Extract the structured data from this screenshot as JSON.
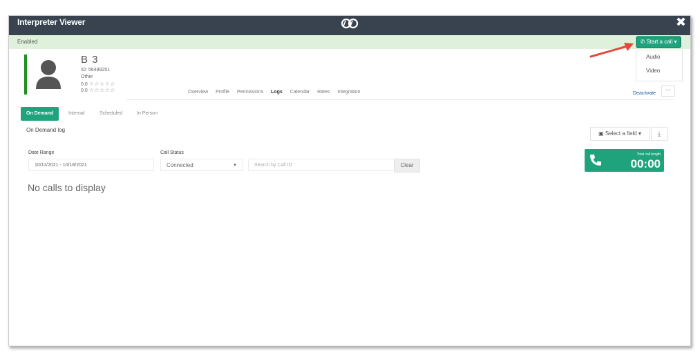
{
  "window": {
    "title": "Interpreter Viewer",
    "close_label": "✖"
  },
  "status": {
    "text": "Enabled",
    "start_call_label": "Start a call",
    "call_options": [
      "Audio",
      "Video"
    ]
  },
  "profile": {
    "name": "B 3",
    "id": "ID: 56489251",
    "type": "Other",
    "rating1": "0.0",
    "rating2": "0.0",
    "stars": "☆☆☆☆☆"
  },
  "tabs": [
    "Overview",
    "Profile",
    "Permissions",
    "Logs",
    "Calendar",
    "Rates",
    "Integration"
  ],
  "active_tab": "Logs",
  "actions": {
    "deactivate": "Deactivate",
    "more": "···"
  },
  "subtabs": [
    "On Demand",
    "Internal",
    "Scheduled",
    "In Person"
  ],
  "log": {
    "title": "On Demand log",
    "select_field": "Select a field",
    "date_range_label": "Date Range",
    "date_range_value": "10/11/2021 - 10/18/2021",
    "call_status_label": "Call Status",
    "call_status_value": "Connected",
    "search_placeholder": "Search by Call ID",
    "clear": "Clear",
    "total_label": "Total call length",
    "total_value": "00:00",
    "empty_text": "No calls to display"
  },
  "colors": {
    "accent": "#1fa37d",
    "topbar": "#38434f",
    "status_bg": "#dff1db",
    "profile_bar": "#1f8f1f"
  }
}
